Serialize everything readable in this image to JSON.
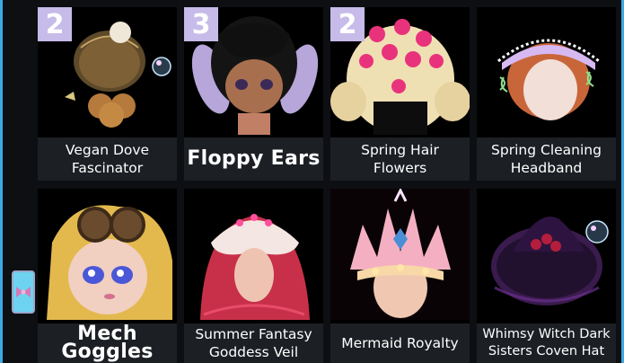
{
  "items": [
    {
      "label": "Vegan Dove Fascinator",
      "badge": "2",
      "icon": "fascinator-icon"
    },
    {
      "label": "Floppy Ears",
      "badge": "3",
      "icon": "floppy-ears-icon"
    },
    {
      "label": "Spring Hair Flowers",
      "badge": "2",
      "icon": "hair-flowers-icon"
    },
    {
      "label": "Spring Cleaning Headband",
      "icon": "headband-icon"
    },
    {
      "label": "Mech Goggles",
      "icon": "goggles-icon"
    },
    {
      "label": "Summer Fantasy Goddess Veil",
      "icon": "veil-icon"
    },
    {
      "label": "Mermaid Royalty",
      "icon": "crown-icon"
    },
    {
      "label": "Whimsy Witch Dark Sisters Coven Hat",
      "icon": "witch-hat-icon"
    }
  ],
  "colors": {
    "frame": "#3aa9e6",
    "badge": "#c7bbe9",
    "label_bg": "#1c1f24"
  }
}
